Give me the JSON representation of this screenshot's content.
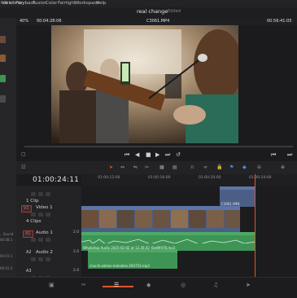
{
  "menubar": {
    "items": [
      "ind Library",
      "View",
      "Playback",
      "Fusion",
      "Color",
      "Fairlight",
      "Workspace",
      "Help"
    ]
  },
  "project": {
    "title": "real change",
    "status": "Edited"
  },
  "viewer": {
    "zoom": "40%",
    "source_timecode": "00:04:28:06",
    "clip_name": "C3061.MP4",
    "record_timecode": "00:56:41:05"
  },
  "timeline": {
    "timecode": "01:00:24:11",
    "ruler_ticks": [
      "01:00:12:00",
      "01:00:16:00",
      "01:00:20:00",
      "01:00:24:00"
    ],
    "tracks": {
      "v2_count": "1 Clip",
      "v1_badge": "V1",
      "v1_name": "Video 1",
      "v1_count": "4 Clips",
      "a1_badge": "A1",
      "a1_name": "Audio 1",
      "a1_level": "2.0",
      "a2_badge": "A2",
      "a2_name": "Audio 2",
      "a2_level": "2.0",
      "a3_badge": "A3",
      "a3_level": "2.0"
    },
    "clips": {
      "v2_clip": "C3061.MP4",
      "a1_clip": "WhatsApp Audio 2025-02-02 at 12.26.02_6ed9f478.mp3",
      "a2_clip": "church-atmos-melodies-293753.mp3"
    }
  },
  "left_panel": {
    "labels": [
      "...Sound",
      "00:08:1",
      "00:01:1",
      "00:01:2",
      "00:01:0"
    ]
  },
  "colors": {
    "accent": "#e0542e",
    "video_clip": "#4b5f86",
    "audio_clip": "#3e9455"
  },
  "icons": [
    "media-page-icon",
    "cut-page-icon",
    "edit-page-icon",
    "fusion-page-icon",
    "color-page-icon",
    "fairlight-page-icon",
    "deliver-page-icon"
  ]
}
